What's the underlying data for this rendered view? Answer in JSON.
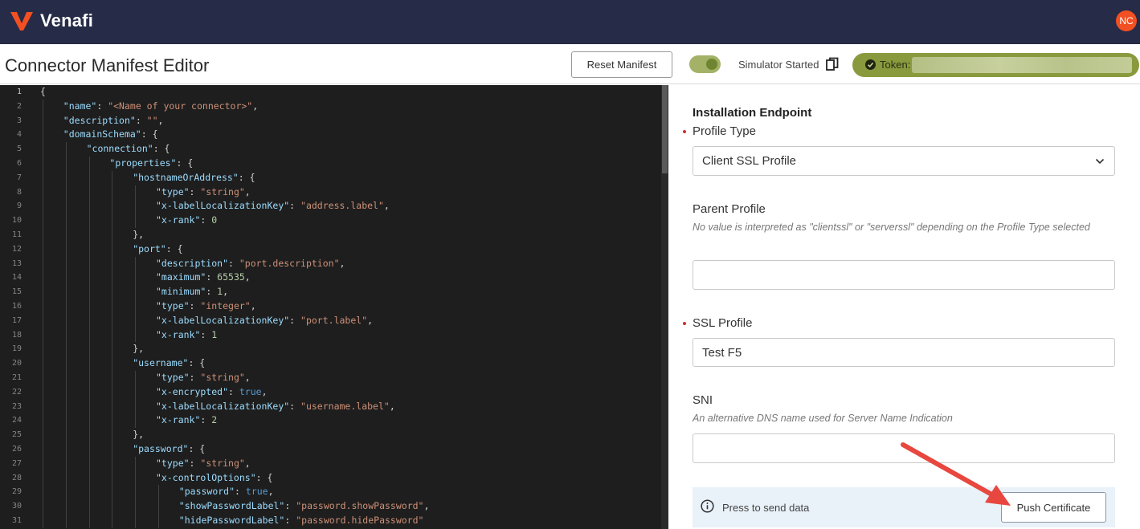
{
  "app": {
    "name": "Venafi",
    "user_initials": "NC",
    "brand_color": "#f25022",
    "header_bg": "#262b47"
  },
  "toolbar": {
    "page_title": "Connector Manifest Editor",
    "reset_label": "Reset Manifest",
    "simulator_status": "Simulator Started",
    "simulator_on": true,
    "token_label": "Token:"
  },
  "editor": {
    "language": "json",
    "lines": [
      {
        "n": "1",
        "indent": 0,
        "parts": [
          [
            "p",
            "{"
          ]
        ]
      },
      {
        "n": "2",
        "indent": 1,
        "parts": [
          [
            "k",
            "\"name\""
          ],
          [
            "p",
            ": "
          ],
          [
            "s",
            "\"<Name of your connector>\""
          ],
          [
            "p",
            ","
          ]
        ]
      },
      {
        "n": "3",
        "indent": 1,
        "parts": [
          [
            "k",
            "\"description\""
          ],
          [
            "p",
            ": "
          ],
          [
            "s",
            "\"\""
          ],
          [
            "p",
            ","
          ]
        ]
      },
      {
        "n": "4",
        "indent": 1,
        "parts": [
          [
            "k",
            "\"domainSchema\""
          ],
          [
            "p",
            ": {"
          ]
        ]
      },
      {
        "n": "5",
        "indent": 2,
        "parts": [
          [
            "k",
            "\"connection\""
          ],
          [
            "p",
            ": {"
          ]
        ]
      },
      {
        "n": "6",
        "indent": 3,
        "parts": [
          [
            "k",
            "\"properties\""
          ],
          [
            "p",
            ": {"
          ]
        ]
      },
      {
        "n": "7",
        "indent": 4,
        "parts": [
          [
            "k",
            "\"hostnameOrAddress\""
          ],
          [
            "p",
            ": {"
          ]
        ]
      },
      {
        "n": "8",
        "indent": 5,
        "parts": [
          [
            "k",
            "\"type\""
          ],
          [
            "p",
            ": "
          ],
          [
            "s",
            "\"string\""
          ],
          [
            "p",
            ","
          ]
        ]
      },
      {
        "n": "9",
        "indent": 5,
        "parts": [
          [
            "k",
            "\"x-labelLocalizationKey\""
          ],
          [
            "p",
            ": "
          ],
          [
            "s",
            "\"address.label\""
          ],
          [
            "p",
            ","
          ]
        ]
      },
      {
        "n": "10",
        "indent": 5,
        "parts": [
          [
            "k",
            "\"x-rank\""
          ],
          [
            "p",
            ": "
          ],
          [
            "n",
            "0"
          ]
        ]
      },
      {
        "n": "11",
        "indent": 4,
        "parts": [
          [
            "p",
            "},"
          ]
        ]
      },
      {
        "n": "12",
        "indent": 4,
        "parts": [
          [
            "k",
            "\"port\""
          ],
          [
            "p",
            ": {"
          ]
        ]
      },
      {
        "n": "13",
        "indent": 5,
        "parts": [
          [
            "k",
            "\"description\""
          ],
          [
            "p",
            ": "
          ],
          [
            "s",
            "\"port.description\""
          ],
          [
            "p",
            ","
          ]
        ]
      },
      {
        "n": "14",
        "indent": 5,
        "parts": [
          [
            "k",
            "\"maximum\""
          ],
          [
            "p",
            ": "
          ],
          [
            "n",
            "65535"
          ],
          [
            "p",
            ","
          ]
        ]
      },
      {
        "n": "15",
        "indent": 5,
        "parts": [
          [
            "k",
            "\"minimum\""
          ],
          [
            "p",
            ": "
          ],
          [
            "n",
            "1"
          ],
          [
            "p",
            ","
          ]
        ]
      },
      {
        "n": "16",
        "indent": 5,
        "parts": [
          [
            "k",
            "\"type\""
          ],
          [
            "p",
            ": "
          ],
          [
            "s",
            "\"integer\""
          ],
          [
            "p",
            ","
          ]
        ]
      },
      {
        "n": "17",
        "indent": 5,
        "parts": [
          [
            "k",
            "\"x-labelLocalizationKey\""
          ],
          [
            "p",
            ": "
          ],
          [
            "s",
            "\"port.label\""
          ],
          [
            "p",
            ","
          ]
        ]
      },
      {
        "n": "18",
        "indent": 5,
        "parts": [
          [
            "k",
            "\"x-rank\""
          ],
          [
            "p",
            ": "
          ],
          [
            "n",
            "1"
          ]
        ]
      },
      {
        "n": "19",
        "indent": 4,
        "parts": [
          [
            "p",
            "},"
          ]
        ]
      },
      {
        "n": "20",
        "indent": 4,
        "parts": [
          [
            "k",
            "\"username\""
          ],
          [
            "p",
            ": {"
          ]
        ]
      },
      {
        "n": "21",
        "indent": 5,
        "parts": [
          [
            "k",
            "\"type\""
          ],
          [
            "p",
            ": "
          ],
          [
            "s",
            "\"string\""
          ],
          [
            "p",
            ","
          ]
        ]
      },
      {
        "n": "22",
        "indent": 5,
        "parts": [
          [
            "k",
            "\"x-encrypted\""
          ],
          [
            "p",
            ": "
          ],
          [
            "b",
            "true"
          ],
          [
            "p",
            ","
          ]
        ]
      },
      {
        "n": "23",
        "indent": 5,
        "parts": [
          [
            "k",
            "\"x-labelLocalizationKey\""
          ],
          [
            "p",
            ": "
          ],
          [
            "s",
            "\"username.label\""
          ],
          [
            "p",
            ","
          ]
        ]
      },
      {
        "n": "24",
        "indent": 5,
        "parts": [
          [
            "k",
            "\"x-rank\""
          ],
          [
            "p",
            ": "
          ],
          [
            "n",
            "2"
          ]
        ]
      },
      {
        "n": "25",
        "indent": 4,
        "parts": [
          [
            "p",
            "},"
          ]
        ]
      },
      {
        "n": "26",
        "indent": 4,
        "parts": [
          [
            "k",
            "\"password\""
          ],
          [
            "p",
            ": {"
          ]
        ]
      },
      {
        "n": "27",
        "indent": 5,
        "parts": [
          [
            "k",
            "\"type\""
          ],
          [
            "p",
            ": "
          ],
          [
            "s",
            "\"string\""
          ],
          [
            "p",
            ","
          ]
        ]
      },
      {
        "n": "28",
        "indent": 5,
        "parts": [
          [
            "k",
            "\"x-controlOptions\""
          ],
          [
            "p",
            ": {"
          ]
        ]
      },
      {
        "n": "29",
        "indent": 6,
        "parts": [
          [
            "k",
            "\"password\""
          ],
          [
            "p",
            ": "
          ],
          [
            "b",
            "true"
          ],
          [
            "p",
            ","
          ]
        ]
      },
      {
        "n": "30",
        "indent": 6,
        "parts": [
          [
            "k",
            "\"showPasswordLabel\""
          ],
          [
            "p",
            ": "
          ],
          [
            "s",
            "\"password.showPassword\""
          ],
          [
            "p",
            ","
          ]
        ]
      },
      {
        "n": "31",
        "indent": 6,
        "parts": [
          [
            "k",
            "\"hidePasswordLabel\""
          ],
          [
            "p",
            ": "
          ],
          [
            "s",
            "\"password.hidePassword\""
          ]
        ]
      }
    ]
  },
  "form": {
    "title": "Installation Endpoint",
    "profile_type": {
      "label": "Profile Type",
      "required": true,
      "value": "Client SSL Profile"
    },
    "parent_profile": {
      "label": "Parent Profile",
      "help": "No value is interpreted as \"clientssl\" or \"serverssl\" depending on the Profile Type selected",
      "value": ""
    },
    "ssl_profile": {
      "label": "SSL Profile",
      "required": true,
      "value": "Test F5"
    },
    "sni": {
      "label": "SNI",
      "help": "An alternative DNS name used for Server Name Indication",
      "value": ""
    },
    "action_hint": "Press to send data",
    "push_label": "Push Certificate"
  },
  "colors": {
    "accent_arrow": "#e8473f",
    "required": "#d12f2f",
    "toggle_on": "#6f8531",
    "token_bg": "#899a3e"
  }
}
